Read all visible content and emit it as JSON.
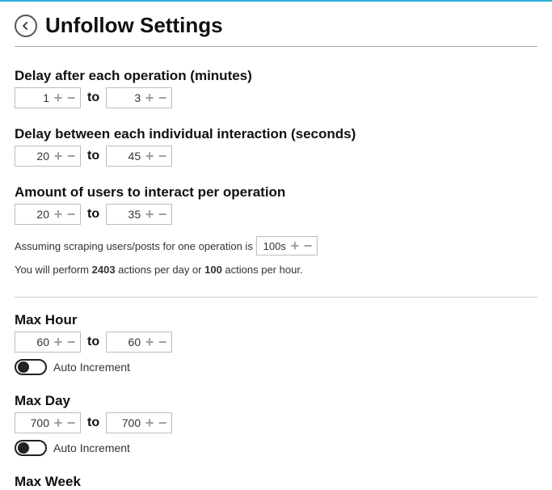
{
  "header": {
    "title": "Unfollow Settings"
  },
  "sections": {
    "delayOperation": {
      "label": "Delay after each operation (minutes)",
      "from": "1",
      "to": "3",
      "toWord": "to"
    },
    "delayInteraction": {
      "label": "Delay between each individual interaction (seconds)",
      "from": "20",
      "to": "45",
      "toWord": "to"
    },
    "usersPerOperation": {
      "label": "Amount of users to interact per operation",
      "from": "20",
      "to": "35",
      "toWord": "to"
    },
    "maxHour": {
      "label": "Max Hour",
      "from": "60",
      "to": "60",
      "toWord": "to",
      "autoIncrement": "Auto Increment"
    },
    "maxDay": {
      "label": "Max Day",
      "from": "700",
      "to": "700",
      "toWord": "to",
      "autoIncrement": "Auto Increment"
    },
    "maxWeek": {
      "label": "Max Week"
    }
  },
  "scraping": {
    "prefix": "Assuming scraping users/posts for one operation is",
    "value": "100s"
  },
  "estimate": {
    "p1": "You will perform ",
    "actionsDay": "2403",
    "p2": " actions per day or ",
    "actionsHour": "100",
    "p3": " actions per hour."
  }
}
